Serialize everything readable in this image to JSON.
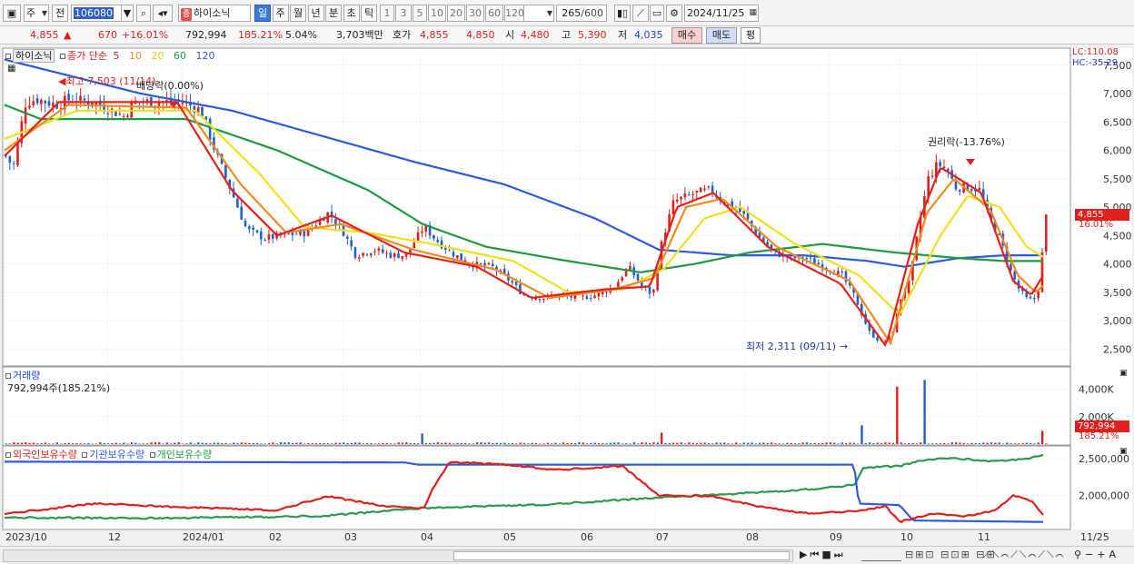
{
  "toolbar": {
    "period_dropdown": "주",
    "prefix_label": "전",
    "stock_code": "106080",
    "stock_name": "하이소닉",
    "name_badge": "종",
    "period_tabs": [
      {
        "label": "일",
        "selected": true
      },
      {
        "label": "주",
        "selected": false
      },
      {
        "label": "월",
        "selected": false
      },
      {
        "label": "년",
        "selected": false
      },
      {
        "label": "분",
        "selected": false
      },
      {
        "label": "초",
        "selected": false
      },
      {
        "label": "틱",
        "selected": false
      }
    ],
    "interval_tabs": [
      "1",
      "3",
      "5",
      "10",
      "20",
      "30",
      "60",
      "120"
    ],
    "count_display": "265",
    "count_total": "/600",
    "date_value": "2024/11/25"
  },
  "quote": {
    "price": "4,855",
    "change": "670",
    "change_pct": "+16.01%",
    "volume": "792,994",
    "volume_pct": "185.21%",
    "turnover_rate": "5.04%",
    "amount": "3,703백만",
    "ask_label": "호가",
    "ask_price": "4,855",
    "bid_price": "4,850",
    "open_label": "시",
    "open": "4,480",
    "high_label": "고",
    "high": "5,390",
    "low_label": "저",
    "low": "4,035",
    "buy_button": "매수",
    "sell_button": "매도",
    "eval_button": "평"
  },
  "price_panel": {
    "stock_tag": "하이소닉",
    "ma_legend": {
      "label": "종가 단순",
      "periods": [
        "5",
        "10",
        "20",
        "60",
        "120"
      ]
    },
    "colors": {
      "ma5": "#e8201c",
      "ma10": "#f08c1c",
      "ma20": "#f0e01c",
      "ma60": "#1c9a3c",
      "ma120": "#2c5ae0",
      "up": "#e0201c",
      "down": "#2060d0"
    },
    "lc_label": "LC:110.08",
    "hc_label": "HC:-35.29",
    "y_ticks": [
      "7,500",
      "7,000",
      "6,500",
      "6,000",
      "5,500",
      "5,000",
      "4,500",
      "4,000",
      "3,500",
      "3,000",
      "2,500"
    ],
    "current_price_tag": "4,855",
    "current_pct_tag": "16.01%",
    "annotations": {
      "high": "최고 7,503 (11/14)",
      "ex_dividend": "배당락(0.00%)",
      "ex_rights": "권리락(-13.76%)",
      "low": "최저 2,311 (09/11)"
    }
  },
  "volume_panel": {
    "title": "거래량",
    "value_label": "792,994주(185.21%)",
    "y_ticks": [
      "4,000K",
      "2,000K"
    ],
    "current_tag": "792,994",
    "current_pct_tag": "185.21%"
  },
  "holdings_panel": {
    "legend": [
      "외국인보유수량",
      "기관보유수량",
      "개인보유수량"
    ],
    "y_ticks": [
      "2,500,000",
      "2,000,000"
    ]
  },
  "x_axis": {
    "labels": [
      "2023/10",
      "12",
      "2024/01",
      "02",
      "03",
      "04",
      "05",
      "06",
      "07",
      "08",
      "09",
      "10",
      "11",
      "11/25"
    ]
  },
  "chart_data": {
    "type": "candlestick",
    "price_keypoints": [
      [
        0,
        5900
      ],
      [
        8,
        5700
      ],
      [
        15,
        6300
      ],
      [
        22,
        6850
      ],
      [
        35,
        6900
      ],
      [
        55,
        6800
      ],
      [
        70,
        6900
      ],
      [
        95,
        6850
      ],
      [
        110,
        6750
      ],
      [
        130,
        6600
      ],
      [
        140,
        6850
      ],
      [
        160,
        6850
      ],
      [
        175,
        6850
      ],
      [
        195,
        6850
      ],
      [
        215,
        6700
      ],
      [
        230,
        6000
      ],
      [
        250,
        5200
      ],
      [
        265,
        4600
      ],
      [
        285,
        4450
      ],
      [
        305,
        4500
      ],
      [
        330,
        4550
      ],
      [
        355,
        4900
      ],
      [
        370,
        4600
      ],
      [
        385,
        4150
      ],
      [
        405,
        4250
      ],
      [
        425,
        4150
      ],
      [
        440,
        4150
      ],
      [
        460,
        4650
      ],
      [
        475,
        4400
      ],
      [
        490,
        4200
      ],
      [
        510,
        4000
      ],
      [
        535,
        3950
      ],
      [
        555,
        3700
      ],
      [
        570,
        3450
      ],
      [
        590,
        3400
      ],
      [
        610,
        3450
      ],
      [
        630,
        3400
      ],
      [
        650,
        3450
      ],
      [
        670,
        3600
      ],
      [
        685,
        3950
      ],
      [
        700,
        3600
      ],
      [
        712,
        3450
      ],
      [
        722,
        4400
      ],
      [
        735,
        5100
      ],
      [
        760,
        5250
      ],
      [
        775,
        5300
      ],
      [
        790,
        5100
      ],
      [
        810,
        4900
      ],
      [
        830,
        4450
      ],
      [
        845,
        4200
      ],
      [
        865,
        4100
      ],
      [
        880,
        4100
      ],
      [
        900,
        3950
      ],
      [
        920,
        3800
      ],
      [
        935,
        3400
      ],
      [
        950,
        2800
      ],
      [
        965,
        2600
      ],
      [
        975,
        2750
      ],
      [
        985,
        3400
      ],
      [
        995,
        3700
      ],
      [
        1005,
        4700
      ],
      [
        1015,
        5500
      ],
      [
        1025,
        5750
      ],
      [
        1035,
        5700
      ],
      [
        1045,
        5350
      ],
      [
        1060,
        5350
      ],
      [
        1072,
        5300
      ],
      [
        1080,
        4900
      ],
      [
        1095,
        4400
      ],
      [
        1105,
        3900
      ],
      [
        1115,
        3550
      ],
      [
        1125,
        3350
      ],
      [
        1135,
        3400
      ],
      [
        1140,
        4100
      ],
      [
        1145,
        4855
      ]
    ],
    "ma_keypoints": {
      "ma5": [
        [
          0,
          5900
        ],
        [
          60,
          6850
        ],
        [
          190,
          6850
        ],
        [
          250,
          5300
        ],
        [
          300,
          4500
        ],
        [
          360,
          4850
        ],
        [
          440,
          4200
        ],
        [
          520,
          3950
        ],
        [
          580,
          3400
        ],
        [
          660,
          3550
        ],
        [
          710,
          3600
        ],
        [
          740,
          5000
        ],
        [
          780,
          5250
        ],
        [
          840,
          4300
        ],
        [
          920,
          3650
        ],
        [
          970,
          2550
        ],
        [
          1005,
          4700
        ],
        [
          1030,
          5700
        ],
        [
          1075,
          5250
        ],
        [
          1110,
          3700
        ],
        [
          1130,
          3450
        ],
        [
          1145,
          3850
        ]
      ],
      "ma10": [
        [
          0,
          6000
        ],
        [
          70,
          6800
        ],
        [
          200,
          6750
        ],
        [
          260,
          5400
        ],
        [
          310,
          4550
        ],
        [
          370,
          4700
        ],
        [
          450,
          4250
        ],
        [
          540,
          3900
        ],
        [
          600,
          3400
        ],
        [
          670,
          3550
        ],
        [
          715,
          3750
        ],
        [
          750,
          5000
        ],
        [
          790,
          5150
        ],
        [
          850,
          4300
        ],
        [
          930,
          3700
        ],
        [
          975,
          2600
        ],
        [
          1015,
          4900
        ],
        [
          1045,
          5500
        ],
        [
          1085,
          4950
        ],
        [
          1115,
          3800
        ],
        [
          1135,
          3500
        ],
        [
          1145,
          3650
        ]
      ],
      "ma20": [
        [
          0,
          6200
        ],
        [
          80,
          6700
        ],
        [
          210,
          6700
        ],
        [
          280,
          5600
        ],
        [
          330,
          4650
        ],
        [
          400,
          4550
        ],
        [
          470,
          4350
        ],
        [
          560,
          4050
        ],
        [
          620,
          3500
        ],
        [
          680,
          3550
        ],
        [
          725,
          3900
        ],
        [
          770,
          4800
        ],
        [
          810,
          5000
        ],
        [
          870,
          4350
        ],
        [
          940,
          3800
        ],
        [
          985,
          3100
        ],
        [
          1030,
          4500
        ],
        [
          1060,
          5200
        ],
        [
          1095,
          5000
        ],
        [
          1125,
          4300
        ],
        [
          1145,
          4100
        ]
      ],
      "ma60": [
        [
          0,
          6800
        ],
        [
          40,
          6550
        ],
        [
          200,
          6550
        ],
        [
          300,
          6000
        ],
        [
          400,
          5300
        ],
        [
          460,
          4700
        ],
        [
          530,
          4300
        ],
        [
          620,
          4050
        ],
        [
          700,
          3850
        ],
        [
          760,
          4000
        ],
        [
          820,
          4200
        ],
        [
          900,
          4350
        ],
        [
          980,
          4200
        ],
        [
          1050,
          4100
        ],
        [
          1100,
          4050
        ],
        [
          1145,
          4050
        ]
      ],
      "ma120": [
        [
          0,
          7600
        ],
        [
          50,
          7400
        ],
        [
          150,
          7000
        ],
        [
          250,
          6700
        ],
        [
          350,
          6250
        ],
        [
          450,
          5800
        ],
        [
          550,
          5400
        ],
        [
          650,
          4800
        ],
        [
          720,
          4250
        ],
        [
          800,
          4150
        ],
        [
          880,
          4150
        ],
        [
          950,
          4050
        ],
        [
          990,
          3950
        ],
        [
          1050,
          4100
        ],
        [
          1100,
          4150
        ],
        [
          1145,
          4150
        ]
      ]
    },
    "volume_spikes": [
      [
        458,
        480
      ],
      [
        720,
        520
      ],
      [
        941,
        850
      ],
      [
        980,
        2600
      ],
      [
        1009,
        2900
      ],
      [
        1140,
        600
      ]
    ],
    "holdings_keypoints": {
      "foreign": [
        [
          0,
          1750000
        ],
        [
          100,
          1890000
        ],
        [
          200,
          1840000
        ],
        [
          300,
          1800000
        ],
        [
          355,
          1990000
        ],
        [
          420,
          1850000
        ],
        [
          462,
          1830000
        ],
        [
          470,
          2070000
        ],
        [
          490,
          2460000
        ],
        [
          550,
          2420000
        ],
        [
          610,
          2350000
        ],
        [
          680,
          2400000
        ],
        [
          720,
          2000000
        ],
        [
          780,
          1990000
        ],
        [
          830,
          1850000
        ],
        [
          880,
          1760000
        ],
        [
          930,
          1780000
        ],
        [
          970,
          1850000
        ],
        [
          985,
          1640000
        ],
        [
          1020,
          1750000
        ],
        [
          1060,
          1720000
        ],
        [
          1090,
          1800000
        ],
        [
          1110,
          2000000
        ],
        [
          1130,
          1930000
        ],
        [
          1145,
          1700000
        ]
      ],
      "institution": [
        [
          0,
          2460000
        ],
        [
          440,
          2450000
        ],
        [
          455,
          2420000
        ],
        [
          935,
          2420000
        ],
        [
          940,
          1890000
        ],
        [
          985,
          1870000
        ],
        [
          1000,
          1660000
        ],
        [
          1145,
          1640000
        ]
      ],
      "individual": [
        [
          0,
          1700000
        ],
        [
          150,
          1690000
        ],
        [
          350,
          1720000
        ],
        [
          460,
          1830000
        ],
        [
          600,
          1880000
        ],
        [
          680,
          1940000
        ],
        [
          760,
          2000000
        ],
        [
          860,
          2060000
        ],
        [
          935,
          2140000
        ],
        [
          945,
          2380000
        ],
        [
          985,
          2400000
        ],
        [
          1010,
          2480000
        ],
        [
          1045,
          2510000
        ],
        [
          1080,
          2470000
        ],
        [
          1120,
          2490000
        ],
        [
          1145,
          2550000
        ]
      ]
    }
  }
}
